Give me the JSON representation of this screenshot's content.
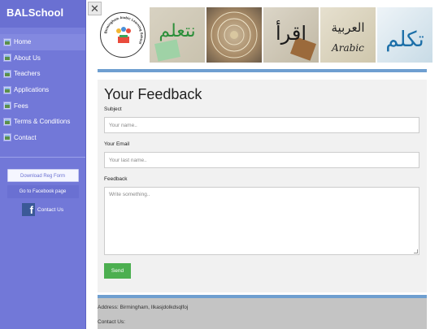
{
  "sidebar": {
    "brand": "BALSchool",
    "items": [
      {
        "label": "Home",
        "active": true
      },
      {
        "label": "About Us"
      },
      {
        "label": "Teachers"
      },
      {
        "label": "Applications"
      },
      {
        "label": "Fees"
      },
      {
        "label": "Terms & Conditions"
      },
      {
        "label": "Contact"
      }
    ],
    "reg_button": "Download Reg Form",
    "fb_button": "Go to Facebook page",
    "contact_label": "Contact Us",
    "fb_glyph": "f"
  },
  "close_glyph": "✕",
  "header": {
    "logo_ring_text": "Birmingham Arabic Learning School",
    "tile_texts": [
      "نتعلم",
      "",
      "اقرأ",
      "العربية",
      "تكلم"
    ],
    "tile4_caption": "Arabic"
  },
  "form": {
    "title": "Your Feedback",
    "subject_label": "Subject",
    "subject_placeholder": "Your name..",
    "email_label": "Your Email",
    "email_placeholder": "Your last name..",
    "feedback_label": "Feedback",
    "feedback_placeholder": "Write something..",
    "send_label": "Send"
  },
  "footer": {
    "address": "Address: Birmingham, Ilkasjdolkdsqlfoj",
    "contact": "Contact Us:"
  },
  "colors": {
    "sidebar": "#7278d8",
    "accent_bar": "#6f9fd0",
    "send": "#4caf50",
    "footer": "#c4c4c4"
  }
}
